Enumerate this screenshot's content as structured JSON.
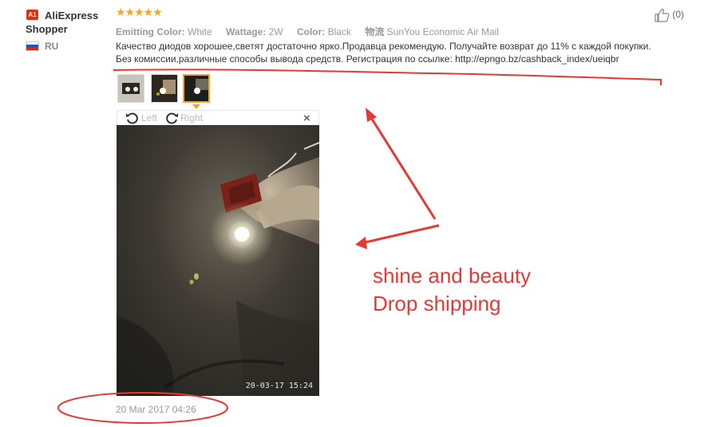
{
  "reviewer": {
    "badge": "A1",
    "name": "AliExpress Shopper",
    "country": "RU"
  },
  "rating": {
    "stars": "★★★★★",
    "value": 5
  },
  "attributes": [
    {
      "key": "Emitting Color:",
      "value": "White"
    },
    {
      "key": "Wattage:",
      "value": "2W"
    },
    {
      "key": "Color:",
      "value": "Black"
    },
    {
      "key": "物流",
      "value": "SunYou Economic Air Mail"
    }
  ],
  "helpful": {
    "count": "(0)"
  },
  "review_text": {
    "line1": "Качество диодов хорошее,светят достаточно ярко.Продавца рекомендую. Получайте возврат до 11% с каждой покупки.",
    "line2": "Без комиссии,различные способы вывода средств. Регистрация по ссылке: http://epngo.bz/cashback_index/ueiqbr"
  },
  "viewer": {
    "left_label": "Left",
    "right_label": "Right",
    "close_glyph": "×",
    "photo_timestamp": "20-03-17  15:24"
  },
  "review_date": "20 Mar 2017 04:26",
  "annotations": {
    "line1": "shine and beauty",
    "line2": "Drop shipping"
  },
  "colors": {
    "accent": "#f5a623",
    "brand_red": "#e62e04",
    "annotation_red": "#e53935"
  }
}
